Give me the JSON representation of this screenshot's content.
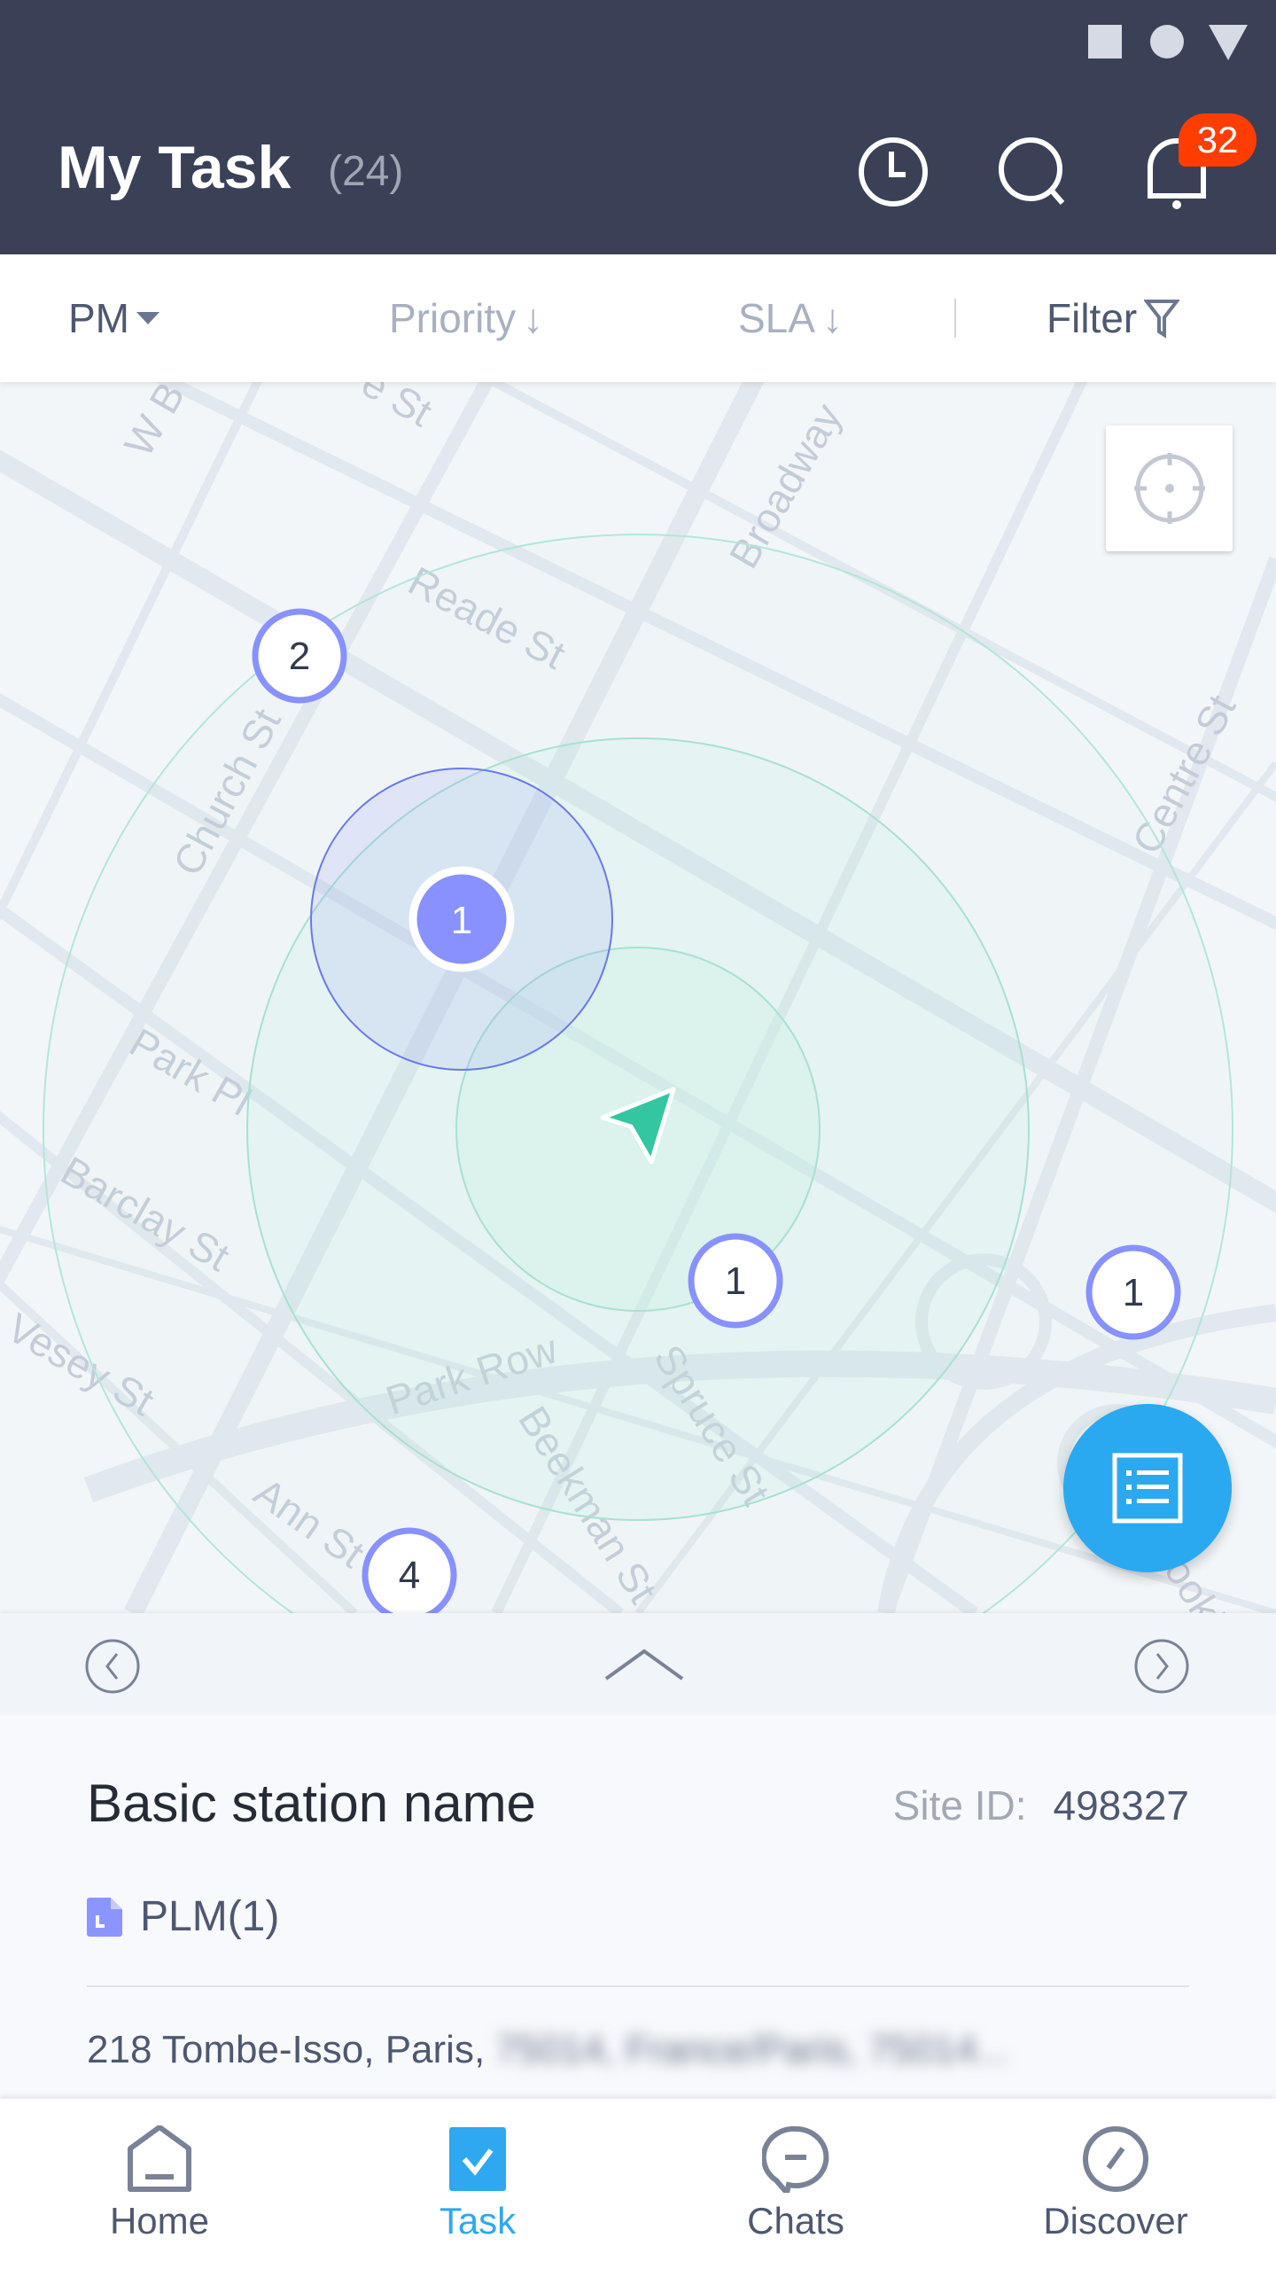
{
  "status_bar": {
    "icons": [
      "square-icon",
      "circle-icon",
      "triangle-icon"
    ]
  },
  "header": {
    "title": "My Task",
    "count": "(24)",
    "icons": [
      "clock-icon",
      "search-icon",
      "bell-icon"
    ],
    "notification_count": "32",
    "bg_color": "#3a4157",
    "badge_color": "#ff3d00"
  },
  "filter_bar": {
    "pm": "PM",
    "priority": "Priority",
    "sla": "SLA",
    "filter": "Filter"
  },
  "map": {
    "street_labels": [
      "W B",
      "e St",
      "Broadway",
      "Reade St",
      "Church St",
      "Centre St",
      "Park Pl",
      "Barclay St",
      "Vesey St",
      "Park Row",
      "Spruce St",
      "Beekman St",
      "Ann St",
      "ookl"
    ],
    "clusters": [
      {
        "count": "2"
      },
      {
        "count": "1",
        "selected": true
      },
      {
        "count": "1"
      },
      {
        "count": "1"
      },
      {
        "count": "4"
      }
    ],
    "marker_color": "#8891ff",
    "accent_color": "#34c6a0"
  },
  "fab": {
    "icon": "list-icon",
    "color": "#2aa9f0"
  },
  "sheet": {
    "prev_icon": "chevron-left-icon",
    "expand_icon": "chevron-up-icon",
    "next_icon": "chevron-right-icon"
  },
  "card": {
    "station_name": "Basic station name",
    "site_id_label": "Site ID:",
    "site_id": "498327",
    "plm": "PLM(1)",
    "address": "218 Tombe-Isso, Paris,",
    "address_blurred": "75014, France/Paris, 75014..."
  },
  "tabs": [
    {
      "label": "Home",
      "icon": "home-icon"
    },
    {
      "label": "Task",
      "icon": "task-check-icon",
      "active": true
    },
    {
      "label": "Chats",
      "icon": "chat-icon"
    },
    {
      "label": "Discover",
      "icon": "compass-icon"
    }
  ]
}
